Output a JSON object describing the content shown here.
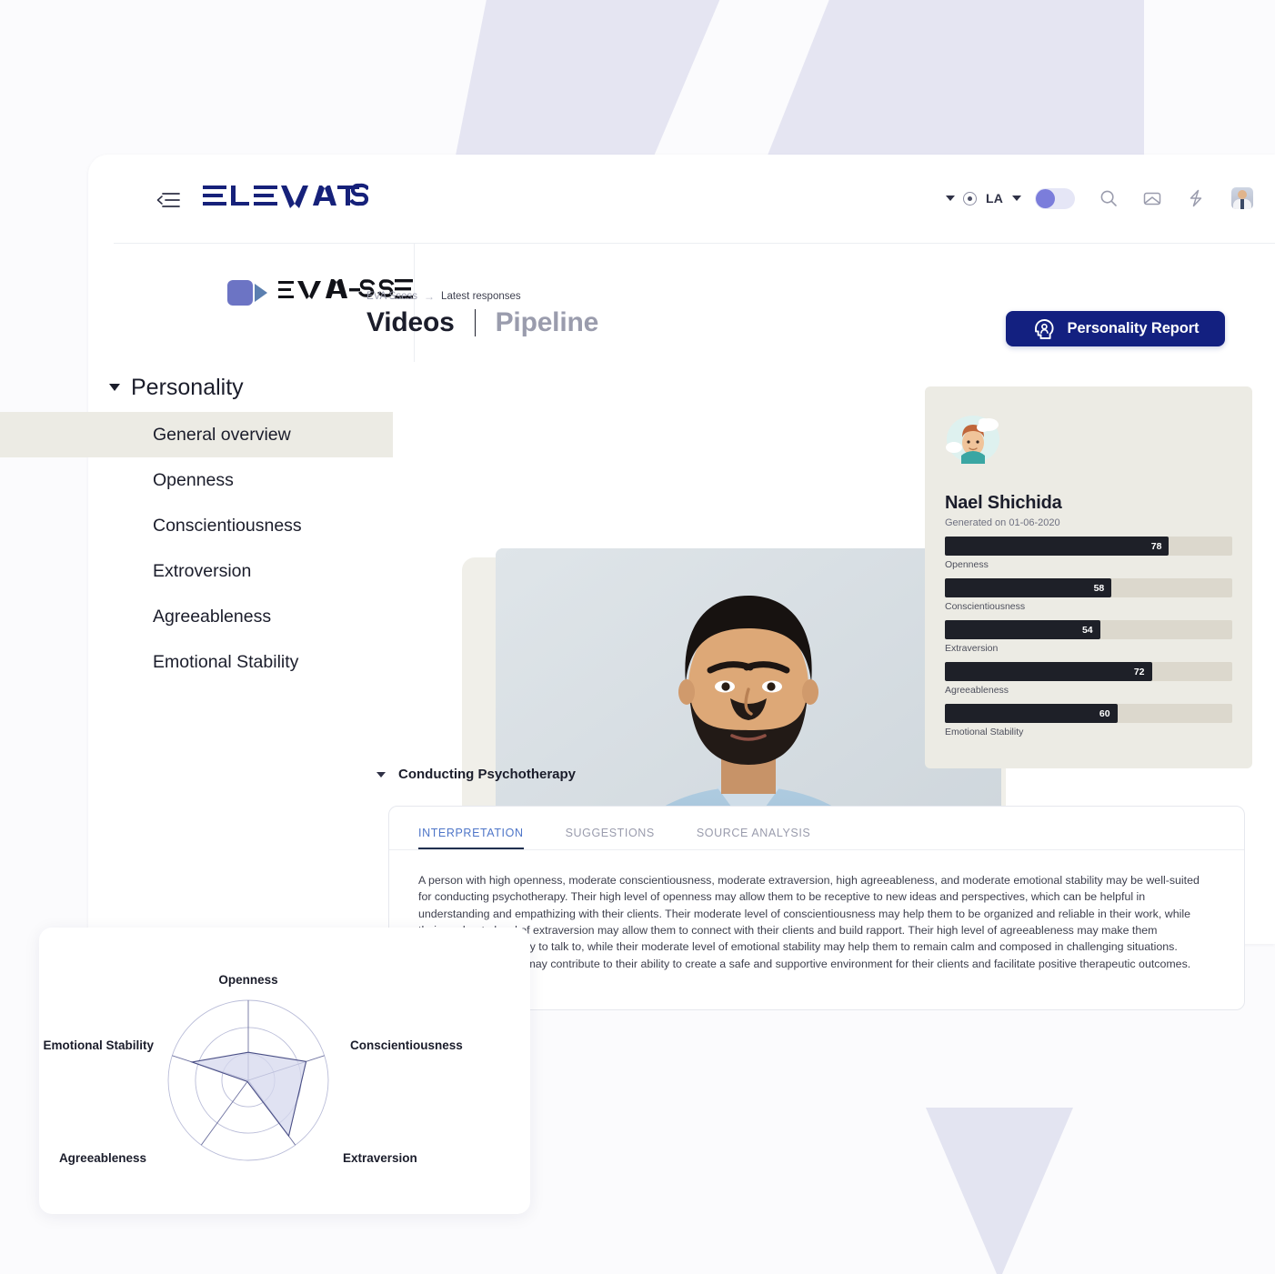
{
  "header": {
    "brand": "ELEVATUS",
    "menu_icon": "collapse-menu-icon",
    "locale": "LA",
    "icons": [
      "search-icon",
      "inbox-icon",
      "bolt-icon",
      "avatar"
    ]
  },
  "subheader": {
    "product": "EVA-SSESS",
    "breadcrumb": {
      "root": "EVA Ssess",
      "arrow": "→",
      "current": "Latest responses"
    },
    "title_main": "Videos",
    "title_alt": "Pipeline",
    "report_button": "Personality Report",
    "report_button_icon": "head-profile-icon"
  },
  "sidebar": {
    "group_title": "Personality",
    "items": [
      {
        "label": "General overview",
        "active": true
      },
      {
        "label": "Openness",
        "active": false
      },
      {
        "label": "Conscientiousness",
        "active": false
      },
      {
        "label": "Extroversion",
        "active": false
      },
      {
        "label": "Agreeableness",
        "active": false
      },
      {
        "label": "Emotional Stability",
        "active": false
      }
    ]
  },
  "report": {
    "illustration": "daydreaming-head-icon",
    "name": "Nael Shichida",
    "generated": "Generated on 01-06-2020",
    "traits": [
      {
        "label": "Openness",
        "value": 78
      },
      {
        "label": "Conscientiousness",
        "value": 58
      },
      {
        "label": "Extraversion",
        "value": 54
      },
      {
        "label": "Agreeableness",
        "value": 72
      },
      {
        "label": "Emotional Stability",
        "value": 60
      }
    ]
  },
  "section": {
    "title": "Conducting Psychotherapy",
    "tabs": [
      {
        "label": "INTERPRETATION",
        "active": true
      },
      {
        "label": "SUGGESTIONS",
        "active": false
      },
      {
        "label": "SOURCE ANALYSIS",
        "active": false
      }
    ],
    "body": "A person with high openness, moderate conscientiousness, moderate extraversion, high agreeableness, and moderate emotional stability may be well-suited for conducting psychotherapy. Their high level of openness may allow them to be receptive to new ideas and perspectives, which can be helpful in understanding and empathizing with their clients. Their moderate level of conscientiousness may help them to be organized and reliable in their work, while their moderate level of extraversion may allow them to connect with their clients and build rapport. Their high level of agreeableness may make them approachable and easy to talk to, while their moderate level of emotional stability may help them to remain calm and composed in challenging situations. Together, these traits may contribute to their ability to create a safe and supportive environment for their clients and facilitate positive therapeutic outcomes."
  },
  "chart_data": {
    "type": "radar",
    "title": "",
    "categories": [
      "Openness",
      "Conscientiousness",
      "Extraversion",
      "Agreeableness",
      "Emotional Stability"
    ],
    "values": [
      35,
      76,
      86,
      2,
      74
    ],
    "rmax": 100,
    "rings": [
      33,
      66,
      100
    ],
    "legend": "none",
    "label_positions": [
      "top",
      "right",
      "bottom-right",
      "bottom-left",
      "left"
    ]
  },
  "colors": {
    "brand_navy": "#142080",
    "accent_indigo": "#6c74c4",
    "report_card_bg": "#ecebe4",
    "bar_fill": "#1e2028",
    "bar_track": "#dcd8cd",
    "tab_active": "#4f76c8",
    "radar_fill": "#d6d8ee",
    "bg_shape": "#e5e5f2"
  }
}
